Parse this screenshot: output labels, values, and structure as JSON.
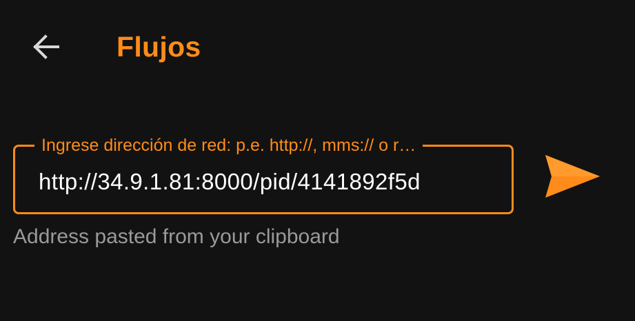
{
  "header": {
    "back_icon": "arrow-left-icon",
    "title": "Flujos"
  },
  "stream_field": {
    "label": "Ingrese dirección de red: p.e. http://, mms:// o r…",
    "value": "http://34.9.1.81:8000/pid/4141892f5d"
  },
  "send_button": {
    "icon": "send-icon"
  },
  "helper": {
    "text": "Address pasted from your clipboard"
  },
  "colors": {
    "accent": "#ff8c1a",
    "background": "#121212",
    "text": "#ffffff",
    "muted": "#9a9a9a",
    "icon": "#d9d9d9"
  }
}
